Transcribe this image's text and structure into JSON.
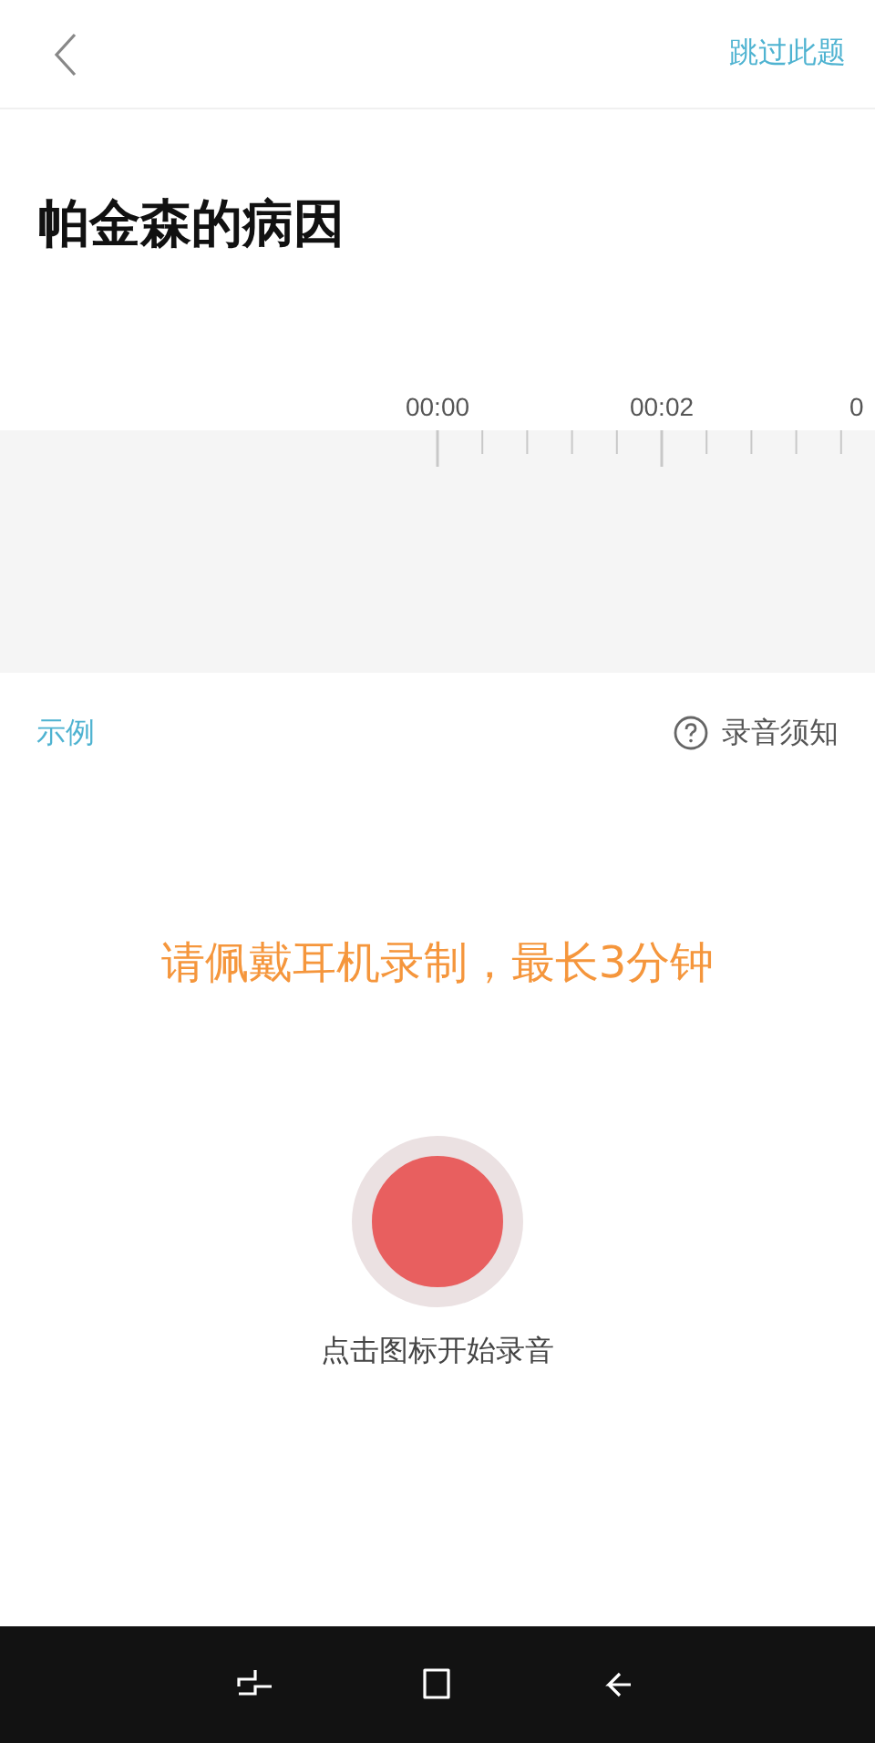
{
  "top_bar": {
    "skip": "跳过此题"
  },
  "title": "帕金森的病因",
  "timeline": {
    "labels": [
      "00:00",
      "00:02",
      "0"
    ]
  },
  "links": {
    "example": "示例",
    "help": "录音须知"
  },
  "hint": "请佩戴耳机录制，最长3分钟",
  "record": {
    "caption": "点击图标开始录音"
  },
  "nav_bar": {
    "buttons": [
      {
        "kind": "recent"
      },
      {
        "kind": "home"
      },
      {
        "kind": "back"
      }
    ]
  }
}
